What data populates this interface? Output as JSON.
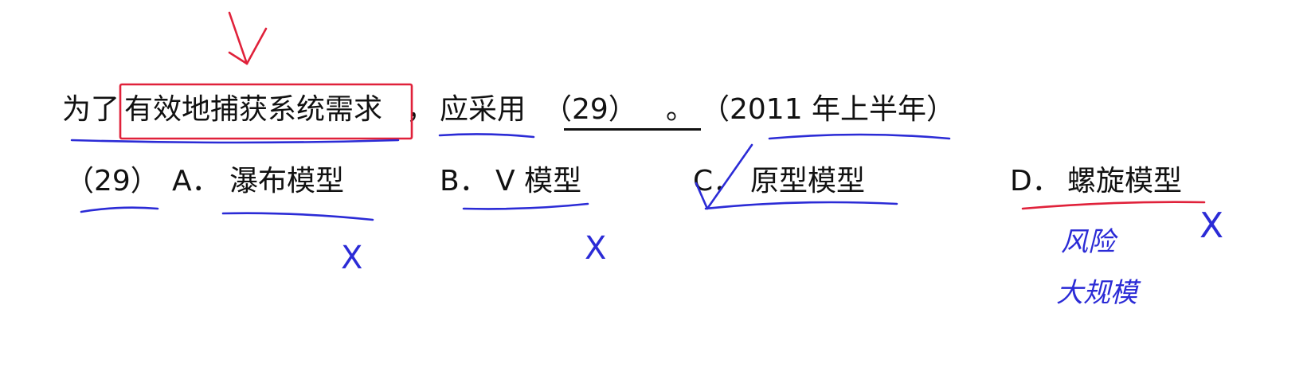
{
  "question": {
    "prefix": "为了",
    "highlight": "有效地捕获系统需求",
    "comma": "，",
    "verb": "应采用",
    "blank_number": "（29）",
    "period": "。",
    "source": "（2011 年上半年）"
  },
  "options": {
    "number": "（29）",
    "a": {
      "letter": "A．",
      "text": "瀑布模型"
    },
    "b": {
      "letter": "B．",
      "text": "V 模型"
    },
    "c": {
      "letter": "C．",
      "text": "原型模型"
    },
    "d": {
      "letter": "D．",
      "text": "螺旋模型"
    }
  },
  "annotations": {
    "mark_a": "X",
    "mark_b": "X",
    "mark_d": "X",
    "note_d_line1": "风险",
    "note_d_line2": "大规模",
    "ink_colors": {
      "blue": "#2b2bd6",
      "red": "#e0213a"
    }
  }
}
